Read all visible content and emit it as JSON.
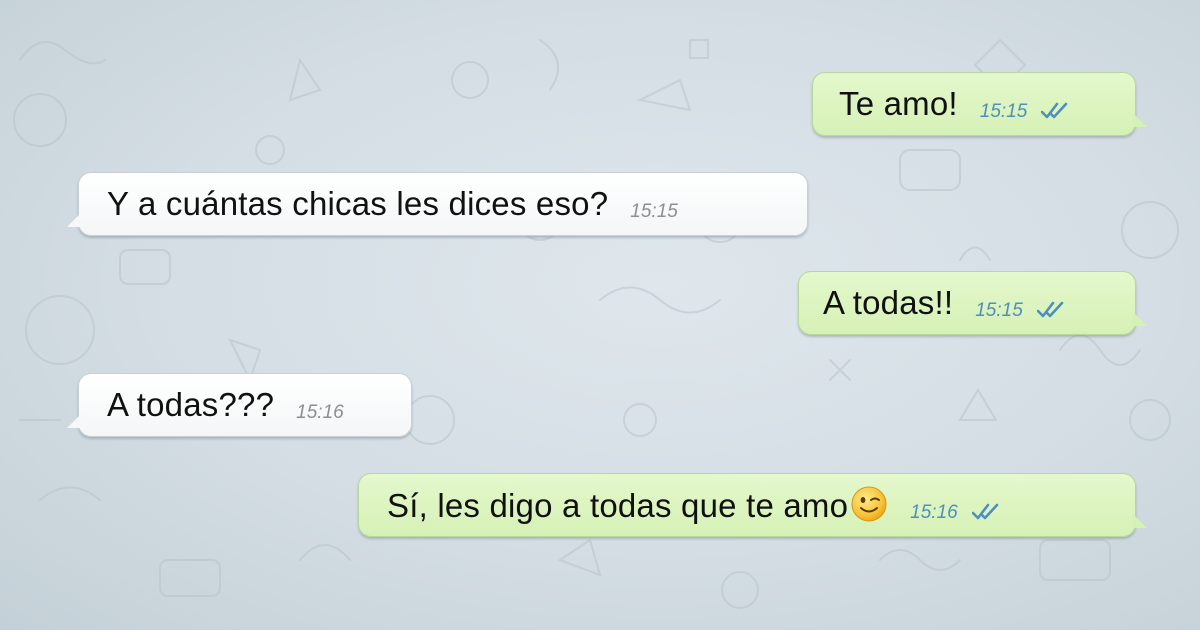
{
  "conversation": {
    "messages": [
      {
        "direction": "outgoing",
        "text": "Te amo!",
        "time": "15:15",
        "status_icon": "double-check-icon"
      },
      {
        "direction": "incoming",
        "text": "Y a cuántas chicas les dices eso?",
        "time": "15:15"
      },
      {
        "direction": "outgoing",
        "text": "A todas!!",
        "time": "15:15",
        "status_icon": "double-check-icon"
      },
      {
        "direction": "incoming",
        "text": "A todas???",
        "time": "15:16"
      },
      {
        "direction": "outgoing",
        "text": "Sí, les digo a todas que te amo",
        "time": "15:16",
        "status_icon": "double-check-icon",
        "emoji": "winking-face-emoji"
      }
    ]
  },
  "colors": {
    "incoming_bubble": "#ffffff",
    "outgoing_bubble": "#dcf8c6",
    "tick_color": "#4e8fbe",
    "wallpaper": "#d3dde3"
  }
}
